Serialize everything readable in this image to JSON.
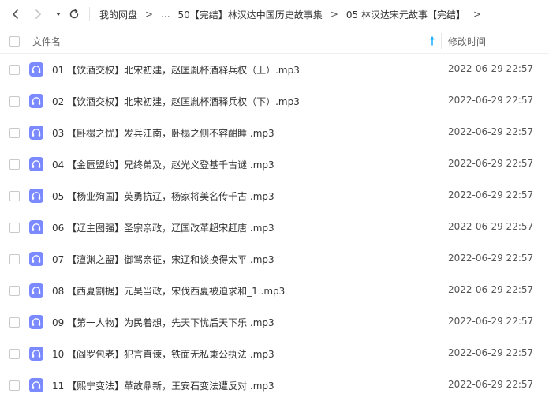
{
  "breadcrumb": {
    "root": "我的网盘",
    "ellipsis": "...",
    "parent": "50【完结】林汉达中国历史故事集",
    "current": "05 林汉达宋元故事【完结】"
  },
  "table": {
    "col_name": "文件名",
    "col_time": "修改时间"
  },
  "colors": {
    "accent": "#06a7ff",
    "audio_icon": "#7b8bff"
  },
  "files": [
    {
      "name": "01 【饮酒交权】北宋初建，赵匡胤杯酒释兵权（上）.mp3",
      "time": "2022-06-29 22:57"
    },
    {
      "name": "02 【饮酒交权】北宋初建，赵匡胤杯酒释兵权（下）.mp3",
      "time": "2022-06-29 22:57"
    },
    {
      "name": "03 【卧榻之忧】发兵江南，卧榻之侧不容酣睡 .mp3",
      "time": "2022-06-29 22:57"
    },
    {
      "name": "04 【金匮盟约】兄终弟及，赵光义登基千古谜 .mp3",
      "time": "2022-06-29 22:57"
    },
    {
      "name": "05 【杨业殉国】英勇抗辽，杨家将美名传千古 .mp3",
      "time": "2022-06-29 22:57"
    },
    {
      "name": "06 【辽主图强】圣宗亲政，辽国改革超宋赶唐 .mp3",
      "time": "2022-06-29 22:57"
    },
    {
      "name": "07 【澶渊之盟】御驾亲征，宋辽和谈换得太平 .mp3",
      "time": "2022-06-29 22:57"
    },
    {
      "name": "08 【西夏割据】元昊当政，宋伐西夏被迫求和_1 .mp3",
      "time": "2022-06-29 22:57"
    },
    {
      "name": "09 【第一人物】为民着想，先天下忧后天下乐 .mp3",
      "time": "2022-06-29 22:57"
    },
    {
      "name": "10 【阎罗包老】犯言直谏，铁面无私秉公执法 .mp3",
      "time": "2022-06-29 22:57"
    },
    {
      "name": "11 【熙宁变法】革故鼎新，王安石变法遭反对 .mp3",
      "time": "2022-06-29 22:57"
    }
  ]
}
